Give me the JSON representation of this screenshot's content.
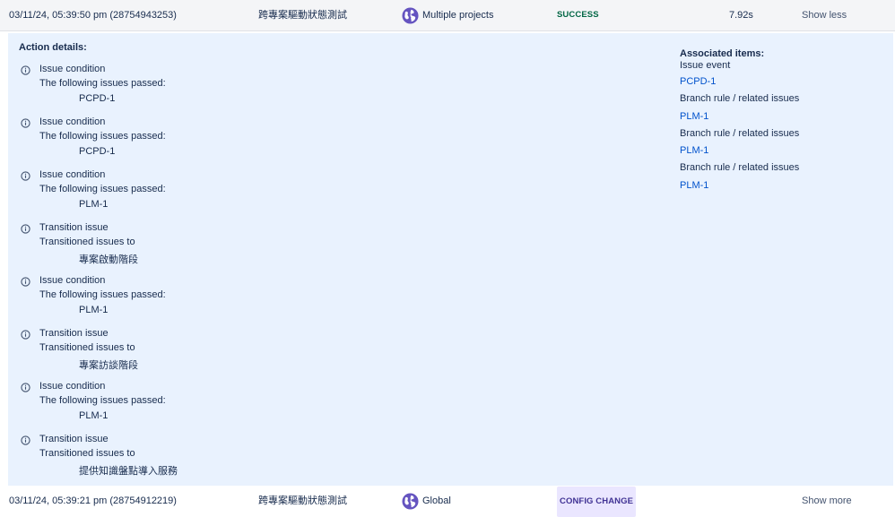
{
  "top_row": {
    "datetime": "03/11/24, 05:39:50 pm (28754943253)",
    "rule_name": "跨專案驅動狀態測試",
    "scope_icon": "globe-icon",
    "scope": "Multiple projects",
    "status": "SUCCESS",
    "duration": "7.92s",
    "toggle": "Show less"
  },
  "details": {
    "action_title": "Action details:",
    "actions": [
      {
        "title": "Issue condition",
        "sub": "The following issues passed:",
        "value": "PCPD-1"
      },
      {
        "title": "Issue condition",
        "sub": "The following issues passed:",
        "value": "PCPD-1"
      },
      {
        "title": "Issue condition",
        "sub": "The following issues passed:",
        "value": "PLM-1"
      },
      {
        "title": "Transition issue",
        "sub": "Transitioned issues to",
        "value": "專案啟動階段"
      },
      {
        "title": "Issue condition",
        "sub": "The following issues passed:",
        "value": "PLM-1"
      },
      {
        "title": "Transition issue",
        "sub": "Transitioned issues to",
        "value": "專案訪談階段"
      },
      {
        "title": "Issue condition",
        "sub": "The following issues passed:",
        "value": "PLM-1"
      },
      {
        "title": "Transition issue",
        "sub": "Transitioned issues to",
        "value": "提供知識盤點導入服務"
      }
    ],
    "assoc_title": "Associated items:",
    "assoc": [
      {
        "label": "Issue event",
        "link": "PCPD-1"
      },
      {
        "label": "Branch rule / related issues",
        "link": "PLM-1"
      },
      {
        "label": "Branch rule / related issues",
        "link": "PLM-1"
      },
      {
        "label": "Branch rule / related issues",
        "link": "PLM-1"
      }
    ]
  },
  "bottom_row": {
    "datetime": "03/11/24, 05:39:21 pm (28754912219)",
    "rule_name": "跨專案驅動狀態測試",
    "scope_icon": "globe-icon",
    "scope": "Global",
    "status": "CONFIG CHANGE",
    "toggle": "Show more"
  },
  "colors": {
    "details_bg": "#e9f2fe",
    "link": "#0052cc",
    "success": "#006644",
    "config": "#403294",
    "globe": "#6554c0"
  }
}
